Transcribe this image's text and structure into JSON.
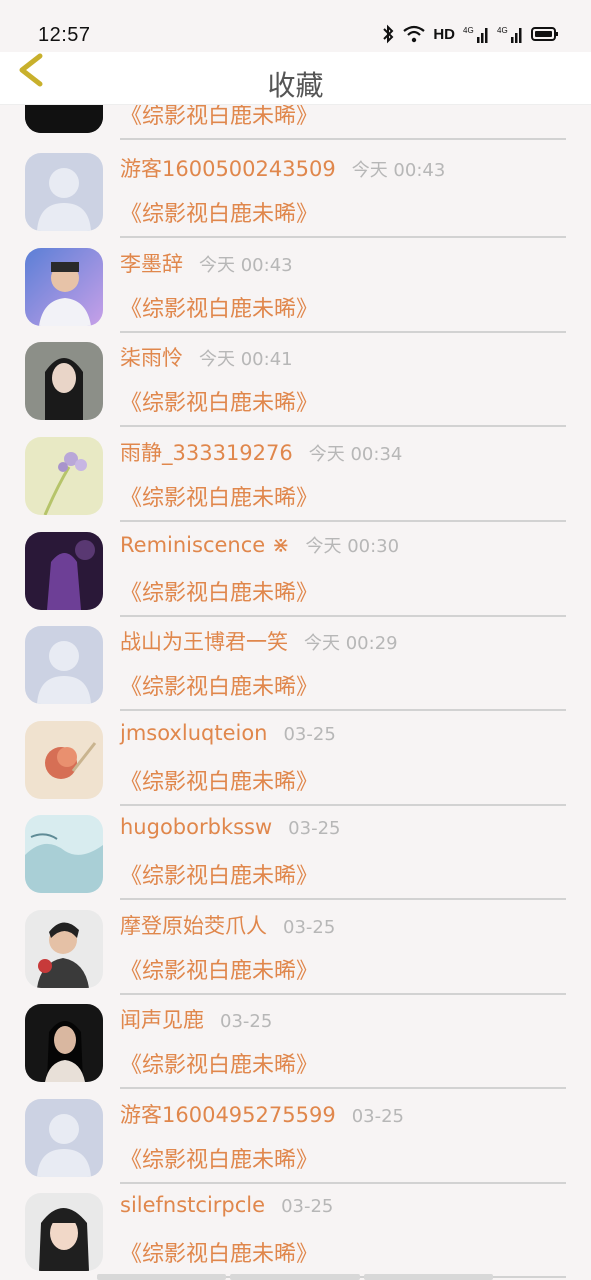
{
  "status_bar": {
    "time": "12:57",
    "network_label": "HD"
  },
  "header": {
    "title": "收藏"
  },
  "rows": [
    {
      "name": "",
      "time": "",
      "content": "《综影视白鹿未晞》",
      "avatar": "dark-text-avatar"
    },
    {
      "name": "游客1600500243509",
      "time": "今天 00:43",
      "content": "《综影视白鹿未晞》",
      "avatar": "default-user-avatar"
    },
    {
      "name": "李墨辞",
      "time": "今天 00:43",
      "content": "《综影视白鹿未晞》",
      "avatar": "photo-avatar"
    },
    {
      "name": "柒雨怜",
      "time": "今天 00:41",
      "content": "《综影视白鹿未晞》",
      "avatar": "photo-avatar"
    },
    {
      "name": "雨静_333319276",
      "time": "今天 00:34",
      "content": "《综影视白鹿未晞》",
      "avatar": "flower-avatar"
    },
    {
      "name": "Reminiscence ⋇",
      "time": "今天 00:30",
      "content": "《综影视白鹿未晞》",
      "avatar": "photo-avatar"
    },
    {
      "name": "战山为王博君一笑",
      "time": "今天 00:29",
      "content": "《综影视白鹿未晞》",
      "avatar": "default-user-avatar"
    },
    {
      "name": "jmsoxluqteion",
      "time": "03-25",
      "content": "《综影视白鹿未晞》",
      "avatar": "flower-avatar"
    },
    {
      "name": "hugoborbkssw",
      "time": "03-25",
      "content": "《综影视白鹿未晞》",
      "avatar": "landscape-avatar"
    },
    {
      "name": "摩登原始茭爪人",
      "time": "03-25",
      "content": "《综影视白鹿未晞》",
      "avatar": "photo-avatar"
    },
    {
      "name": "闻声见鹿",
      "time": "03-25",
      "content": "《综影视白鹿未晞》",
      "avatar": "photo-avatar"
    },
    {
      "name": "游客1600495275599",
      "time": "03-25",
      "content": "《综影视白鹿未晞》",
      "avatar": "default-user-avatar"
    },
    {
      "name": "silefnstcirpcle",
      "time": "03-25",
      "content": "《综影视白鹿未晞》",
      "avatar": "photo-avatar"
    }
  ],
  "colors": {
    "accent": "#e0874c",
    "muted": "#b7b7b7",
    "divider": "#d2d2d2"
  }
}
